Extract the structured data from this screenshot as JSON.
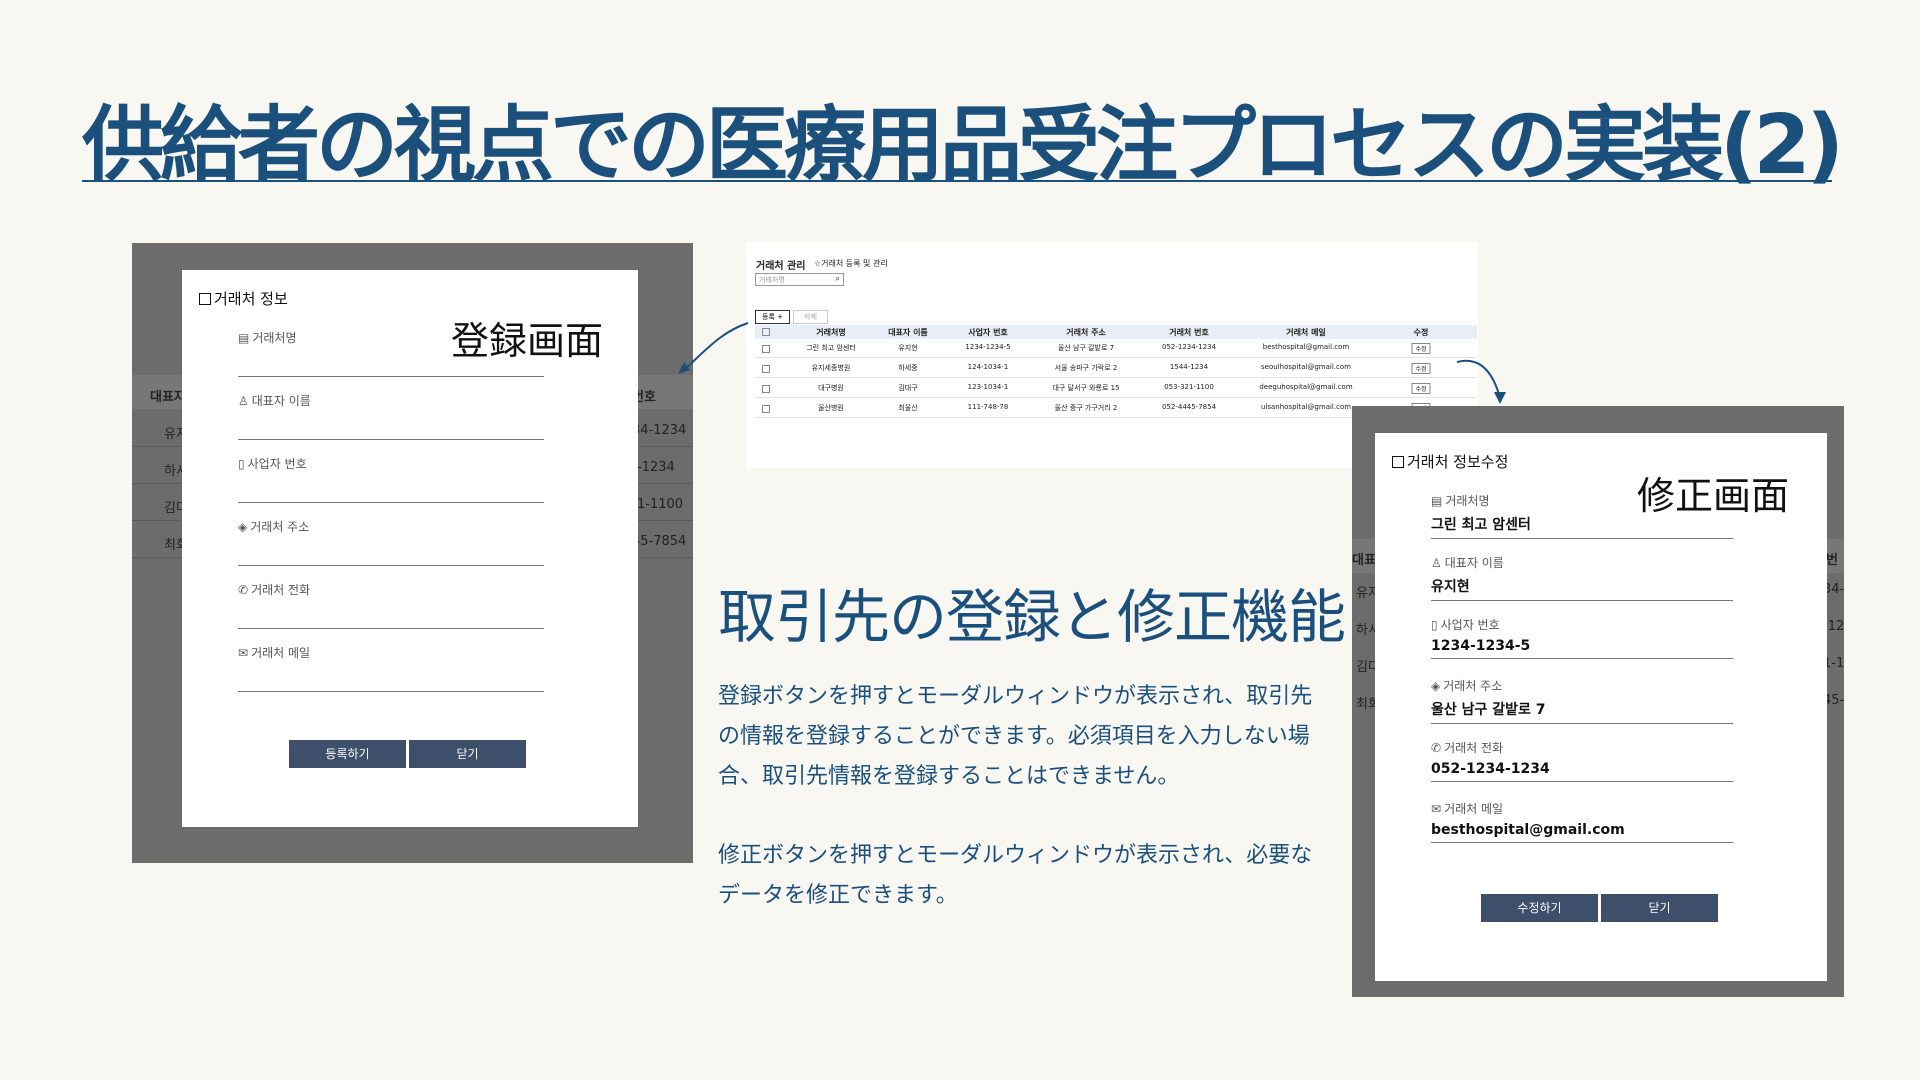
{
  "title": "供給者の視点での医療用品受注プロセスの実装(2)",
  "subtitle": "取引先の登録と修正機能",
  "paragraph1": "登録ボタンを押すとモーダルウィンドウが表示され、取引先の情報を登録することができます。必須項目を入力しない場合、取引先情報を登録することはできません。",
  "paragraph2": "修正ボタンを押すとモーダルウィンドウが表示され、必要なデータを修正できます。",
  "register_modal": {
    "title": "거래처 정보",
    "caption": "登録画面",
    "fields": [
      {
        "icon": "building-icon",
        "glyph": "▤",
        "label": "거래처명"
      },
      {
        "icon": "person-icon",
        "glyph": "♙",
        "label": "대표자 이름"
      },
      {
        "icon": "document-icon",
        "glyph": "▯",
        "label": "사업자 번호"
      },
      {
        "icon": "map-icon",
        "glyph": "◈",
        "label": "거래처 주소"
      },
      {
        "icon": "phone-icon",
        "glyph": "✆",
        "label": "거래처 전화"
      },
      {
        "icon": "mail-icon",
        "glyph": "✉",
        "label": "거래처 메일"
      }
    ],
    "register_button": "등록하기",
    "close_button": "닫기",
    "behind": {
      "header_left": "대표자",
      "header_right": "번호",
      "rows_left": [
        "유지",
        "하시",
        "김다",
        "최회"
      ],
      "rows_right": [
        "34-1234",
        "-1234",
        "1-1100",
        "45-7854"
      ]
    }
  },
  "list_screen": {
    "title": "거래처 관리",
    "star_text": "거래처 등록 및 관리",
    "search_placeholder": "거래처명",
    "register_button": "등록 +",
    "delete_button": "삭제",
    "columns": [
      "",
      "거래처명",
      "대표자 이름",
      "사업자 번호",
      "거래처 주소",
      "거래처 번호",
      "거래처 메일",
      "수정"
    ],
    "rows": [
      [
        "그린 최고 암센터",
        "유지현",
        "1234-1234-5",
        "울산 남구 갈밭로 7",
        "052-1234-1234",
        "besthospital@gmail.com",
        "수정"
      ],
      [
        "유지세종병원",
        "하세중",
        "124-1034-1",
        "서울 송파구 가락로 2",
        "1544-1234",
        "seoulhospital@gmail.com",
        "수정"
      ],
      [
        "대구병원",
        "김대구",
        "123-1034-1",
        "대구 달서구 와룡로 15",
        "053-321-1100",
        "deeguhospital@gmail.com",
        "수정"
      ],
      [
        "울산병원",
        "최울산",
        "111-748-78",
        "울산 중구 가구거리 2",
        "052-4445-7854",
        "ulsanhospital@gmail.com",
        "수정"
      ]
    ]
  },
  "edit_modal": {
    "title": "거래처 정보수정",
    "caption": "修正画面",
    "fields": [
      {
        "icon": "building-icon",
        "glyph": "▤",
        "label": "거래처명",
        "value": "그린 최고 암센터"
      },
      {
        "icon": "person-icon",
        "glyph": "♙",
        "label": "대표자 이름",
        "value": "유지현"
      },
      {
        "icon": "document-icon",
        "glyph": "▯",
        "label": "사업자 번호",
        "value": "1234-1234-5"
      },
      {
        "icon": "map-icon",
        "glyph": "◈",
        "label": "거래처 주소",
        "value": "울산 남구 갈밭로 7"
      },
      {
        "icon": "phone-icon",
        "glyph": "✆",
        "label": "거래처 전화",
        "value": "052-1234-1234"
      },
      {
        "icon": "mail-icon",
        "glyph": "✉",
        "label": "거래처 메일",
        "value": "besthospital@gmail.com"
      }
    ],
    "edit_button": "수정하기",
    "close_button": "닫기",
    "behind": {
      "header_left": "대표",
      "header_right": "번",
      "rows_left": [
        "유지",
        "하시",
        "김다",
        "최회"
      ],
      "rows_right": [
        "34-",
        "-12",
        "1-1",
        "45-"
      ]
    }
  }
}
